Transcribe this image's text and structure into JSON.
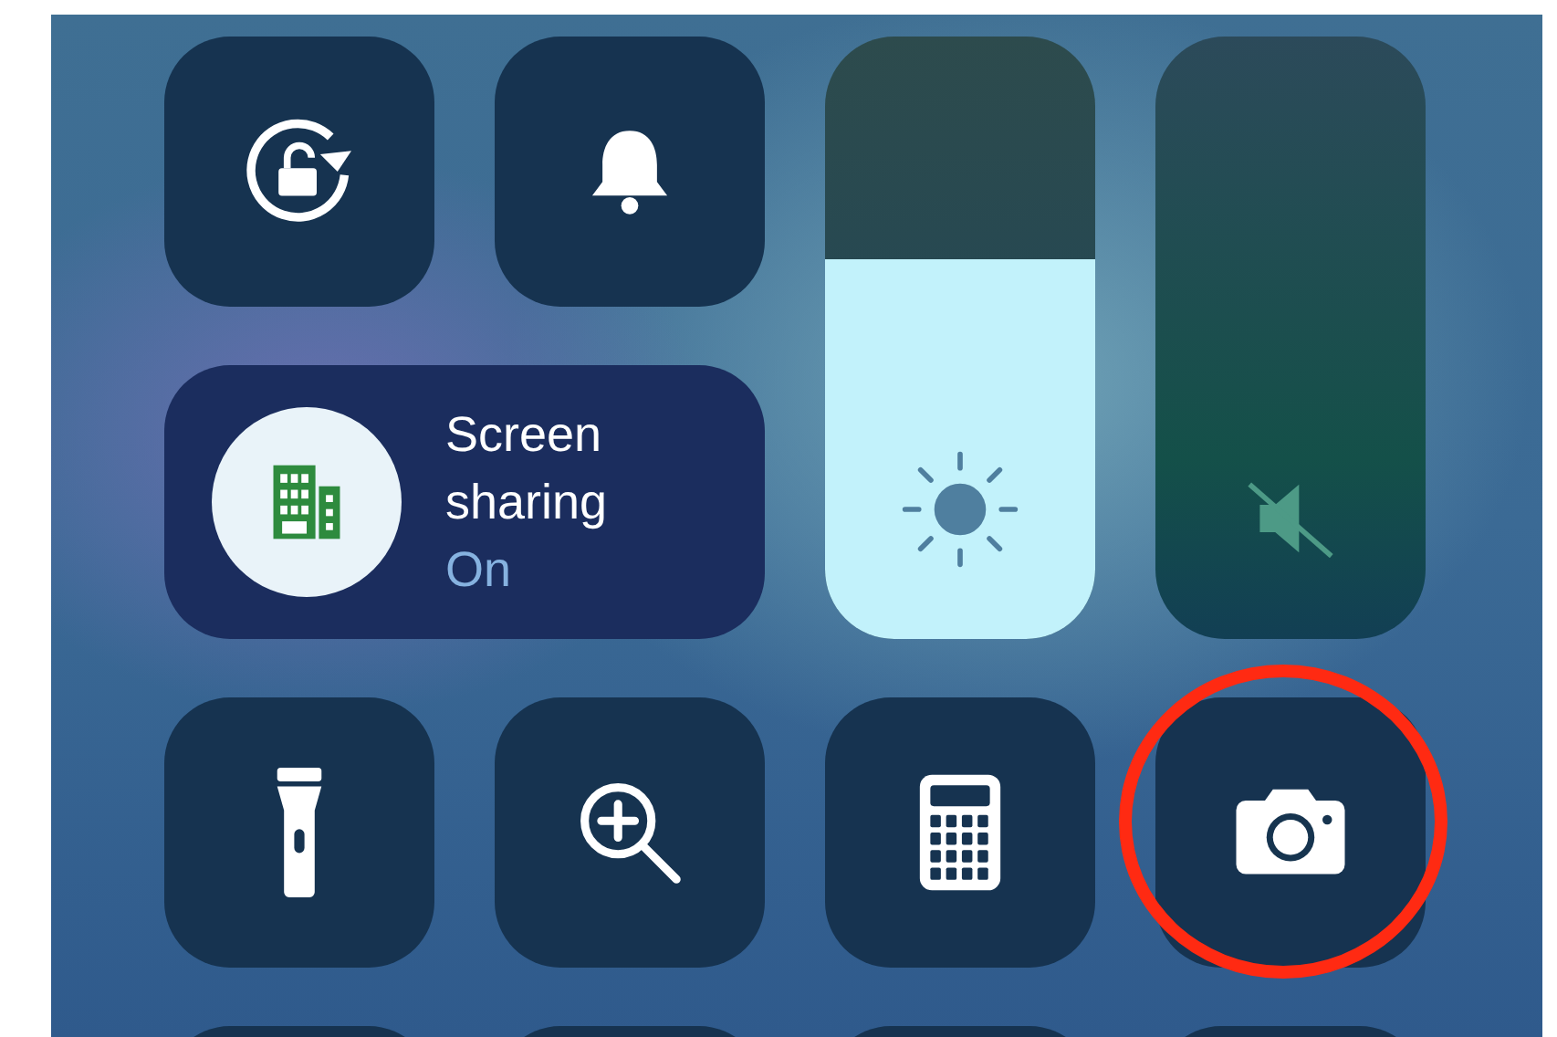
{
  "controls": [
    {
      "kind": "icon",
      "highlighted": false
    },
    {
      "kind": "icon",
      "highlighted": false
    },
    {
      "kind": "slider",
      "level": 0.63
    },
    {
      "kind": "slider",
      "level": 0
    },
    {
      "kind": "wide",
      "title": "Screen sharing",
      "status": "On",
      "on": true
    },
    {
      "kind": "icon",
      "highlighted": false
    },
    {
      "kind": "icon",
      "highlighted": false
    },
    {
      "kind": "icon",
      "highlighted": false
    },
    {
      "kind": "icon",
      "highlighted": true
    },
    {
      "kind": "blank"
    },
    {
      "kind": "blank"
    },
    {
      "kind": "blank"
    },
    {
      "kind": "blank"
    }
  ]
}
